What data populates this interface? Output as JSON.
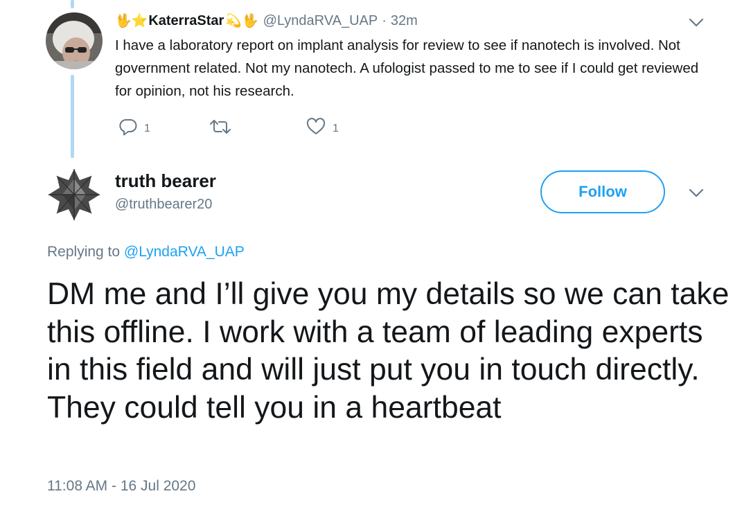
{
  "parent_tweet": {
    "leading_emojis": "🖖⭐",
    "display_name": "KaterraStar",
    "trailing_emojis": "💫🖖",
    "handle": "@LyndaRVA_UAP",
    "separator": "·",
    "time": "32m",
    "text": "I have a laboratory report on implant analysis for review to see if nanotech is involved. Not government related. Not my nanotech. A ufologist passed to me to see if I could get reviewed for opinion, not his research.",
    "reply_count": "1",
    "like_count": "1"
  },
  "reply_tweet": {
    "display_name": "truth bearer",
    "handle": "@truthbearer20",
    "follow_label": "Follow",
    "replying_to_label": "Replying to",
    "replying_to_handle": "@LyndaRVA_UAP",
    "text": "DM me and I’ll give you my details so we can take this offline. I work with a team of leading experts in this field and will just put you in touch directly. They could tell you in a heartbeat",
    "timestamp": "11:08 AM - 16 Jul 2020"
  },
  "icons": {
    "reply": "reply-icon",
    "retweet": "retweet-icon",
    "like": "heart-icon",
    "more": "chevron-down-icon"
  },
  "colors": {
    "accent": "#1da1f2",
    "thread_line": "#afd8f5",
    "secondary_text": "#657786",
    "primary_text": "#14171a"
  }
}
